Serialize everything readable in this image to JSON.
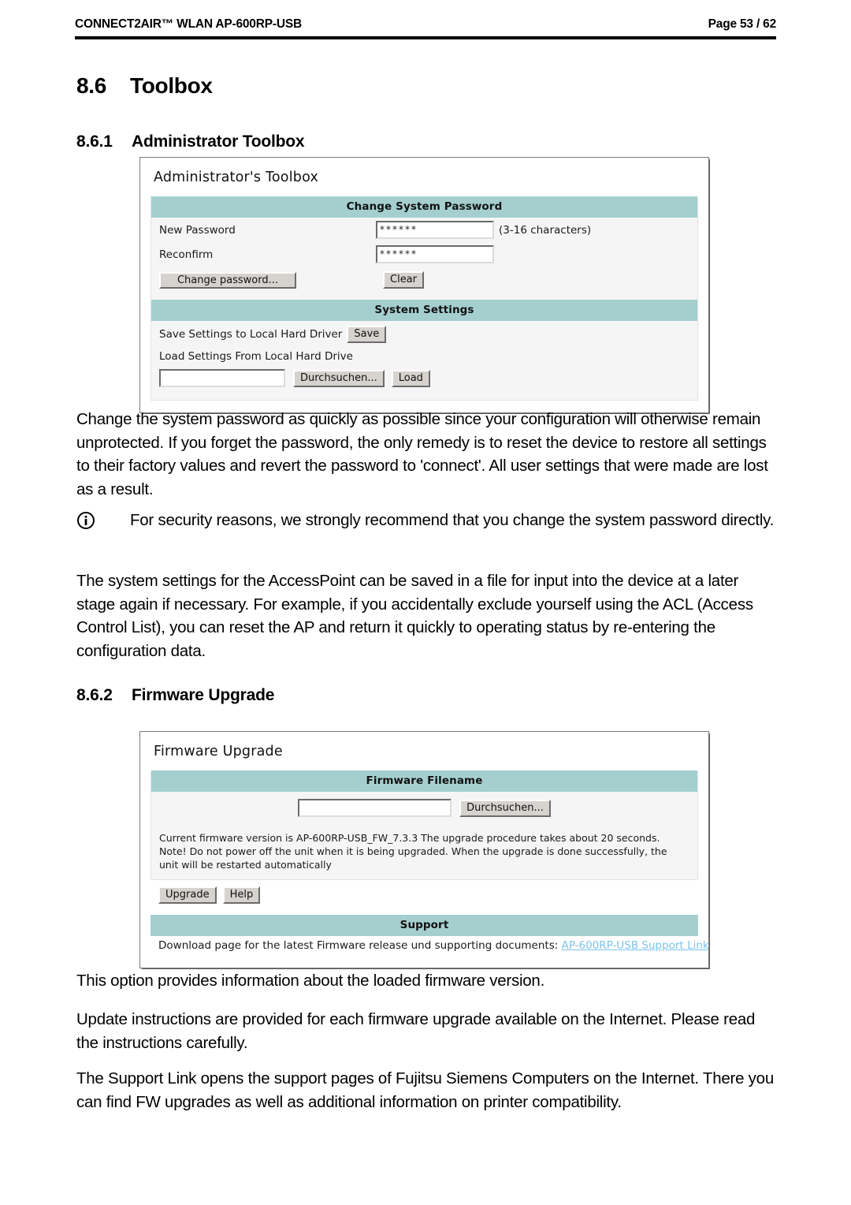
{
  "header": {
    "product": "CONNECT2AIR™ WLAN AP-600RP-USB",
    "page_label": "Page 53 / 62"
  },
  "headings": {
    "h1_number": "8.6",
    "h1_title": "Toolbox",
    "h2_1_number": "8.6.1",
    "h2_1_title": "Administrator Toolbox",
    "h2_2_number": "8.6.2",
    "h2_2_title": "Firmware Upgrade"
  },
  "body": {
    "paragraph_1": "Change the system password as quickly as possible since your configuration will otherwise remain unprotected. If you forget the password, the only remedy is to reset the device to restore all settings to their factory values and revert the password to 'connect'. All user settings that were made are lost as a result.",
    "note_icon": "info-circle-icon",
    "note_text": "For security reasons, we strongly recommend that you change the system password directly.",
    "paragraph_2": "The system settings for the AccessPoint can be saved in a file for input into the device at a later stage again if necessary. For example, if you accidentally exclude yourself using the ACL (Access Control List), you can reset the AP and return it quickly to operating status by re-entering the configuration data.",
    "paragraph_3": "This option provides information about the loaded firmware version.",
    "paragraph_4": "Update instructions are provided for each firmware upgrade available on the Internet. Please read the instructions carefully.",
    "paragraph_5": "The Support Link opens the support pages of Fujitsu Siemens Computers on the Internet. There you can find FW upgrades as well as additional information on printer compatibility."
  },
  "admin_toolbox": {
    "title": "Administrator's Toolbox",
    "password_section_title": "Change System Password",
    "new_password_label": "New Password",
    "new_password_value": "******",
    "password_hint": "(3-16 characters)",
    "reconfirm_label": "Reconfirm",
    "reconfirm_value": "******",
    "change_password_button": "Change password...",
    "clear_button": "Clear",
    "system_settings_title": "System Settings",
    "save_label": "Save Settings to Local Hard Driver",
    "save_button": "Save",
    "load_label": "Load Settings From Local Hard Drive",
    "load_path_value": "",
    "browse_button": "Durchsuchen...",
    "load_button": "Load"
  },
  "firmware_upgrade": {
    "title": "Firmware Upgrade",
    "filename_section_title": "Firmware Filename",
    "filename_value": "",
    "browse_button": "Durchsuchen...",
    "description": "Current firmware version is AP-600RP-USB_FW_7.3.3 The upgrade procedure takes about 20 seconds. Note! Do not power off the unit when it is being upgraded. When the upgrade is done successfully, the unit will be restarted automatically",
    "upgrade_button": "Upgrade",
    "help_button": "Help",
    "support_section_title": "Support",
    "support_text": "Download page for the latest Firmware release und supporting documents:",
    "support_link_label": "AP-600RP-USB Support Link"
  },
  "colors": {
    "section_bar": "#a5cfcf",
    "panel_bg": "#f5f5f5",
    "button_face": "#d6d3ce",
    "link": "#7cc3ec"
  }
}
